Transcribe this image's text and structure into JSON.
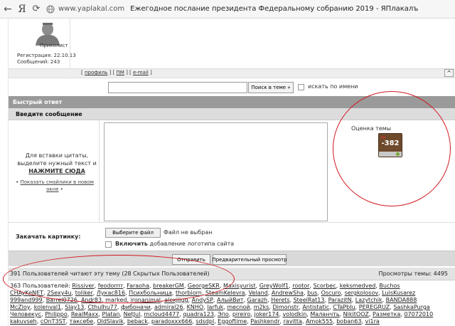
{
  "browser": {
    "url": "www.yaplakal.com",
    "title": "Ежегодное послание президента Федеральному собранию 2019 - ЯПлакалъ",
    "brand": "Я"
  },
  "profile": {
    "nick": "Приколист",
    "registration": "Регистрация: 22.10.13",
    "messages": "Сообщений: 243"
  },
  "profile_links": {
    "profile": "профиль",
    "pm": "ПМ",
    "email": "e-mail",
    "to_top": "^"
  },
  "search": {
    "value": "",
    "button": "Поиск в теме »",
    "by_name": "искать по имени"
  },
  "quick_reply": {
    "title": "Быстрый ответ",
    "enter_message": "Введите сообщение",
    "quote_hint_1": "Для вставки цитаты,",
    "quote_hint_2": "выделите нужный текст и",
    "quote_hint_3": "НАЖМИТЕ СЮДА",
    "smiles_link_1": "Показать смайлики в новом",
    "smiles_link_2": "окне"
  },
  "rating": {
    "label": "Оценка темы",
    "value": "-382"
  },
  "upload": {
    "label": "Закачать картинку:",
    "choose": "Выберите файл",
    "no_file": "Файл не выбран",
    "include": "Включить",
    "logo": "добавление логотипа сайта"
  },
  "buttons": {
    "send": "Отправить",
    "preview": "Предварительный просмотр"
  },
  "readers": {
    "text": "391 Пользователей читают эту тему (28 Скрытых Пользователей)",
    "views": "Просмотры темы: 4495"
  },
  "users": {
    "lead": "363 Пользователей:",
    "rows": [
      [
        "Rissiver",
        "feodorrrr",
        "Faraoha",
        "breakerGM",
        "GeorgeSKR",
        "Maxisyurist",
        "GreyWolf1",
        "rootor",
        "Scorbec",
        "keksmedved",
        "Buchos"
      ],
      [
        "CHAyKeNET",
        "2Sexy4u",
        "toliker",
        "Лукас816",
        "Психбольница",
        "thorbiorn",
        "SteamKelevra",
        "Veland",
        "AndrewSha",
        "bus",
        "Oscuro",
        "sergkolosov",
        "LuisKusarez"
      ],
      [
        "999and999",
        "Barrel0726",
        "Andr83",
        "marked",
        "ironanimal",
        "alexjjjgg",
        "AndySP",
        "АлыйВит",
        "Garazh",
        "Herets",
        "SteelRat13",
        "ParazitN",
        "Lazytchik",
        "BANDA888"
      ],
      [
        "McZloy",
        "kolenval1",
        "Slay13",
        "Cthulhu77",
        "фибоначи",
        "admiral26",
        "KNHO",
        "larfuk",
        "mecnoй",
        "m2ks",
        "Dimonstr",
        "Antistatic",
        "CTaPbIu",
        "PEREGRUZ",
        "SashkaPurga"
      ],
      [
        "Человекус",
        "Philippo",
        "RealMaxx",
        "Platan",
        "NetJul",
        "mcloud4477",
        "quadra123",
        "Эпо",
        "pireiro",
        "joker174",
        "volodkin",
        "Маланчть",
        "NikitOOZ",
        "Разметка",
        "07072010"
      ],
      [
        "kakuvseh",
        "cOnT3ST",
        "таксебе",
        "OldSlavik",
        "beback",
        "paradoxxx666",
        "sdsdpl",
        "Eggoftime",
        "Pashkendr",
        "ravitta",
        "Amok555",
        "boban63",
        "vi1ra"
      ]
    ]
  },
  "annotation_color": "#d0181f"
}
